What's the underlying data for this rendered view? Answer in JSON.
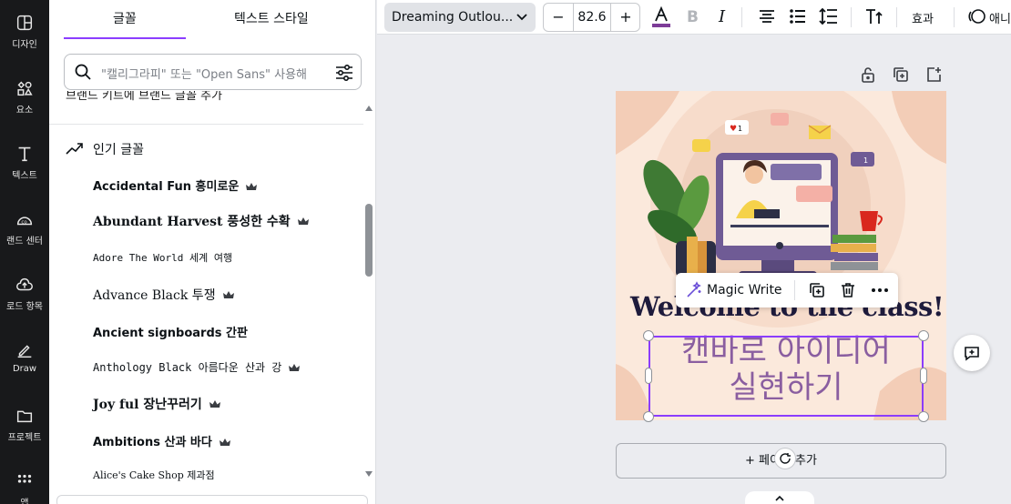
{
  "sidebar": {
    "items": [
      {
        "label": "디자인",
        "icon": "design-icon"
      },
      {
        "label": "요소",
        "icon": "elements-icon"
      },
      {
        "label": "텍스트",
        "icon": "text-icon"
      },
      {
        "label": "랜드 센터",
        "icon": "brand-icon"
      },
      {
        "label": "로드 항목",
        "icon": "upload-icon"
      },
      {
        "label": "Draw",
        "icon": "draw-icon"
      },
      {
        "label": "프로젝트",
        "icon": "folder-icon"
      },
      {
        "label": "앱",
        "icon": "apps-icon"
      }
    ]
  },
  "panel": {
    "tabs": [
      "글꼴",
      "텍스트 스타일"
    ],
    "search_placeholder": "\"캘리그라피\" 또는 \"Open Sans\" 사용해",
    "cut_row": "브랜드 키트에 브랜드 글꼴 추가",
    "popular_title": "인기 글꼴",
    "fonts": [
      {
        "label": "Accidental Fun 흥미로운",
        "crown": true
      },
      {
        "label": "Abundant Harvest 풍성한 수확",
        "crown": true
      },
      {
        "label": "Adore The World 세계 여행",
        "crown": false
      },
      {
        "label": "Advance Black 투쟁",
        "crown": true
      },
      {
        "label": "Ancient signboards 간판",
        "crown": false
      },
      {
        "label": "Anthology Black 아름다운 산과 강",
        "crown": true
      },
      {
        "label": "Joy ful 장난꾸러기",
        "crown": true
      },
      {
        "label": "Ambitions 산과 바다",
        "crown": true
      },
      {
        "label": "Alice's Cake Shop 제과점",
        "crown": false
      }
    ]
  },
  "toolbar": {
    "font_name": "Dreaming Outlou...",
    "font_size": "82.6",
    "minus": "−",
    "plus": "+",
    "effects": "효과",
    "animate": "애니",
    "text_color": "#7d3c98"
  },
  "canvas": {
    "welcome": "Welcome to the class!",
    "korean_line1": "캔바로 아이디어",
    "korean_line2": "실현하기",
    "magic_write": "Magic Write",
    "add_page": "+ 페이지 추가",
    "chat_badges": [
      "1",
      "1"
    ]
  },
  "colors": {
    "accent": "#8b3dff",
    "rail_bg": "#18191b"
  }
}
